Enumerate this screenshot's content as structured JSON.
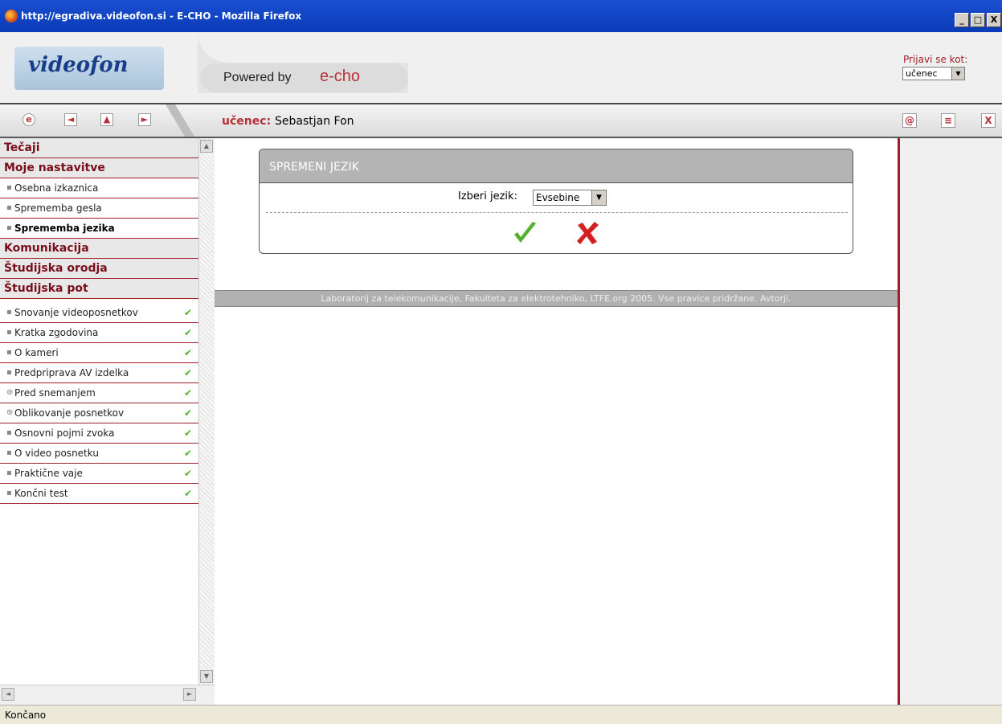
{
  "window": {
    "title": "http://egradiva.videofon.si - E-CHO - Mozilla Firefox",
    "min_label": "_",
    "max_label": "□",
    "close_label": "X"
  },
  "header": {
    "logo": "videofon",
    "powered_by": "Powered by",
    "powered_brand": "e-cho",
    "login_label": "Prijavi se kot:",
    "login_value": "učenec"
  },
  "navbar": {
    "home_icon": "e",
    "back_icon": "◄",
    "up_icon": "▲",
    "forward_icon": "►",
    "user_role": "učenec:",
    "user_name": "Sebastjan Fon",
    "right_icons": {
      "info_icon": "@",
      "notes_icon": "≡",
      "close_icon": "X"
    }
  },
  "sidebar": {
    "sections": [
      {
        "label": "Tečaji"
      },
      {
        "label": "Moje nastavitve"
      },
      {
        "label": "Komunikacija"
      },
      {
        "label": "Študijska orodja"
      },
      {
        "label": "Študijska pot"
      }
    ],
    "settings_items": [
      {
        "label": "Osebna izkaznica",
        "bullet": "▪"
      },
      {
        "label": "Sprememba gesla",
        "bullet": "▪"
      },
      {
        "label": "Sprememba jezika",
        "bullet": "▪",
        "active": true
      }
    ],
    "path_items": [
      {
        "label": "Snovanje videoposnetkov",
        "bullet": "▪",
        "check": "✔"
      },
      {
        "label": "Kratka zgodovina",
        "bullet": "▪",
        "check": "✔"
      },
      {
        "label": "O kameri",
        "bullet": "▪",
        "check": "✔"
      },
      {
        "label": "Predpriprava AV izdelka",
        "bullet": "▪",
        "check": "✔"
      },
      {
        "label": "Pred snemanjem",
        "bullet": "⊕",
        "check": "✔"
      },
      {
        "label": "Oblikovanje posnetkov",
        "bullet": "⊕",
        "check": "✔"
      },
      {
        "label": "Osnovni pojmi zvoka",
        "bullet": "▪",
        "check": "✔"
      },
      {
        "label": "O video posnetku",
        "bullet": "▪",
        "check": "✔"
      },
      {
        "label": "Praktične vaje",
        "bullet": "▪",
        "check": "✔"
      },
      {
        "label": "Končni test",
        "bullet": "▪",
        "check": "✔"
      }
    ]
  },
  "dialog": {
    "title": "SPREMENI JEZIK",
    "lang_label": "Izberi jezik:",
    "lang_value": "Evsebine"
  },
  "footer": {
    "text": "Laboratorij za telekomunikacije, Fakulteta za elektrotehniko, LTFE.org 2005. Vse pravice pridržane. Avtorji."
  },
  "statusbar": {
    "text": "Končano"
  },
  "colors": {
    "accent": "#a01e28",
    "ok_green": "#55b030",
    "cancel_red": "#d42020"
  }
}
